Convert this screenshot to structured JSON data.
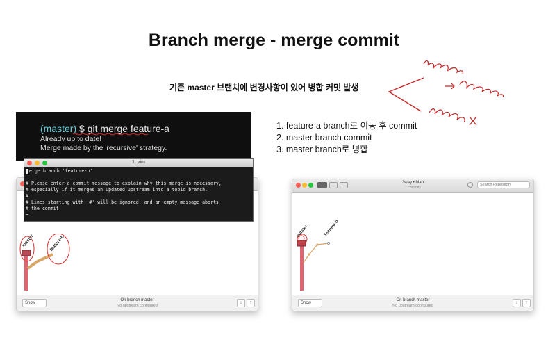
{
  "slide": {
    "title": "Branch merge - merge commit",
    "subtitle": "기존 master 브랜치에 변경사항이 있어 병합 커밋 발생",
    "steps": [
      "1. feature-a branch로 이동 후 commit",
      "2. master branch commit",
      "3. master branch로 병합"
    ]
  },
  "terminal": {
    "prompt_branch": "(master)",
    "prompt_command": " $ git merge feature-a",
    "line2": "Already up to date!",
    "line3": "Merge made by the 'recursive' strategy."
  },
  "vim": {
    "title": "1. vim",
    "lines": [
      "erge branch 'feature-b'",
      "",
      "# Please enter a commit message to explain why this merge is necessary,",
      "# especially if it merges an updated upstream into a topic branch.",
      "#",
      "# Lines starting with '#' will be ignored, and an empty message aborts",
      "# the commit.",
      "~"
    ]
  },
  "left_window": {
    "branches": [
      "master",
      "feature-b"
    ],
    "show_label": "Show",
    "status": "On branch master",
    "upstream": "No upstream configured",
    "btn_down": "↓",
    "btn_up": "↑"
  },
  "right_window": {
    "title": "3way • Map",
    "commits": "7 commits",
    "search_placeholder": "Search Repository",
    "branches": [
      "master",
      "feature-b"
    ],
    "show_label": "Show",
    "status": "On branch master",
    "upstream": "No upstream configured",
    "btn_down": "↓",
    "btn_up": "↑"
  }
}
